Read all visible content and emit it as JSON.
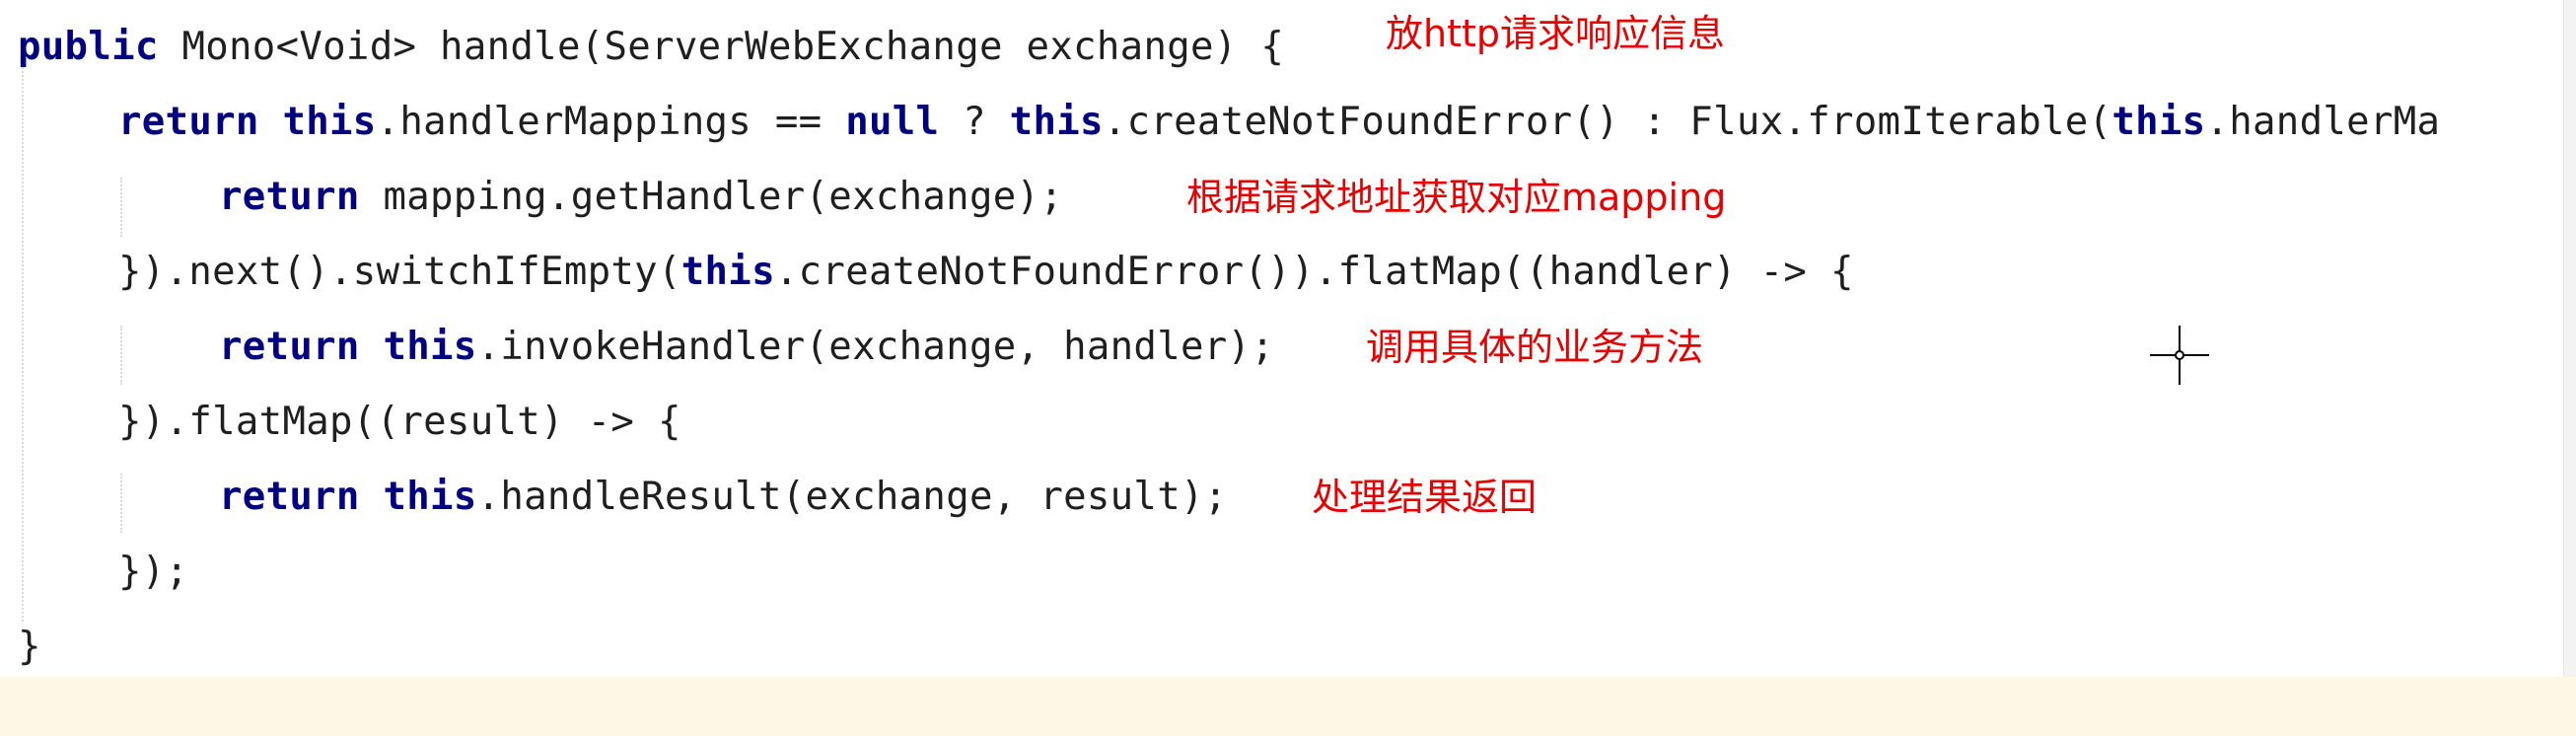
{
  "code": {
    "line1": {
      "kw": "public",
      "rest": " Mono<Void> handle(ServerWebExchange exchange) {"
    },
    "line2": {
      "kw1": "return",
      "sp1": " ",
      "kw2": "this",
      "mid1": ".handlerMappings == ",
      "kw3": "null",
      "mid2": " ? ",
      "kw4": "this",
      "mid3": ".createNotFoundError() : Flux.fromIterable(",
      "kw5": "this",
      "tail": ".handlerMa"
    },
    "line3": {
      "kw": "return",
      "rest": " mapping.getHandler(exchange);"
    },
    "line4": {
      "pre": "}).next().switchIfEmpty(",
      "kw": "this",
      "rest": ".createNotFoundError()).flatMap((handler) -> {"
    },
    "line5": {
      "kw1": "return",
      "sp": " ",
      "kw2": "this",
      "rest": ".invokeHandler(exchange, handler);"
    },
    "line6": {
      "text": "}).flatMap((result) -> {"
    },
    "line7": {
      "kw1": "return",
      "sp": " ",
      "kw2": "this",
      "rest": ".handleResult(exchange, result);"
    },
    "line8": {
      "text": "});"
    },
    "line9": {
      "text": "}"
    }
  },
  "annotations": {
    "note1": "放http请求响应信息",
    "note2": "根据请求地址获取对应mapping",
    "note3": "调用具体的业务方法",
    "note4": "处理结果返回"
  },
  "colors": {
    "keyword": "#000080",
    "annotation": "#e60000",
    "bottom_band": "#fdf7e6"
  },
  "cursor_icon": "crosshair-cursor-icon"
}
